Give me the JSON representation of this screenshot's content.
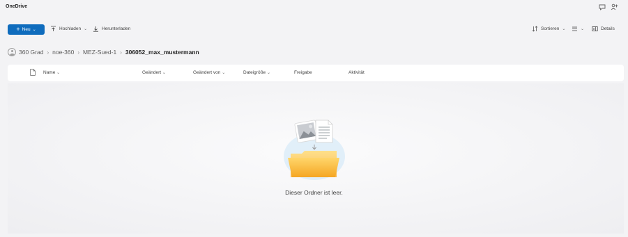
{
  "app": {
    "title": "OneDrive"
  },
  "titlebar_icons": [
    "chat-icon",
    "share-icon"
  ],
  "toolbar": {
    "new_label": "Neu",
    "upload_label": "Hochladen",
    "download_label": "Herunterladen",
    "sort_label": "Sortieren",
    "details_label": "Details"
  },
  "breadcrumb": {
    "items": [
      "360 Grad",
      "noe-360",
      "MEZ-Sued-1"
    ],
    "current": "306052_max_mustermann"
  },
  "columns": {
    "name": "Name",
    "modified": "Geändert",
    "modified_by": "Geändert von",
    "size": "Dateigröße",
    "sharing": "Freigabe",
    "activity": "Aktivität"
  },
  "empty_state": {
    "message": "Dieser Ordner ist leer."
  },
  "colors": {
    "accent": "#0f6cbd",
    "background": "#f3f3f5"
  }
}
